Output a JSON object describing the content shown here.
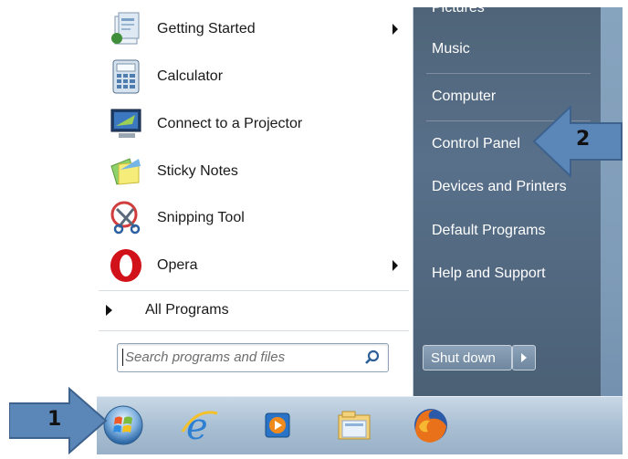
{
  "start_menu": {
    "programs": [
      {
        "label": "Getting Started",
        "icon": "getting-started-icon",
        "submenu": true
      },
      {
        "label": "Calculator",
        "icon": "calculator-icon",
        "submenu": false
      },
      {
        "label": "Connect to a Projector",
        "icon": "projector-icon",
        "submenu": false
      },
      {
        "label": "Sticky Notes",
        "icon": "sticky-notes-icon",
        "submenu": false
      },
      {
        "label": "Snipping Tool",
        "icon": "snipping-tool-icon",
        "submenu": false
      },
      {
        "label": "Opera",
        "icon": "opera-icon",
        "submenu": true
      }
    ],
    "all_programs_label": "All Programs",
    "search_placeholder": "Search programs and files",
    "right_items": [
      "Pictures",
      "Music",
      "Computer",
      "Control Panel",
      "Devices and Printers",
      "Default Programs",
      "Help and Support"
    ],
    "shutdown_label": "Shut down"
  },
  "taskbar": {
    "icons": [
      "start-orb-icon",
      "internet-explorer-icon",
      "media-player-icon",
      "file-explorer-icon",
      "firefox-icon"
    ]
  },
  "callouts": {
    "step1": "1",
    "step2": "2",
    "color": "#5b86b8"
  }
}
